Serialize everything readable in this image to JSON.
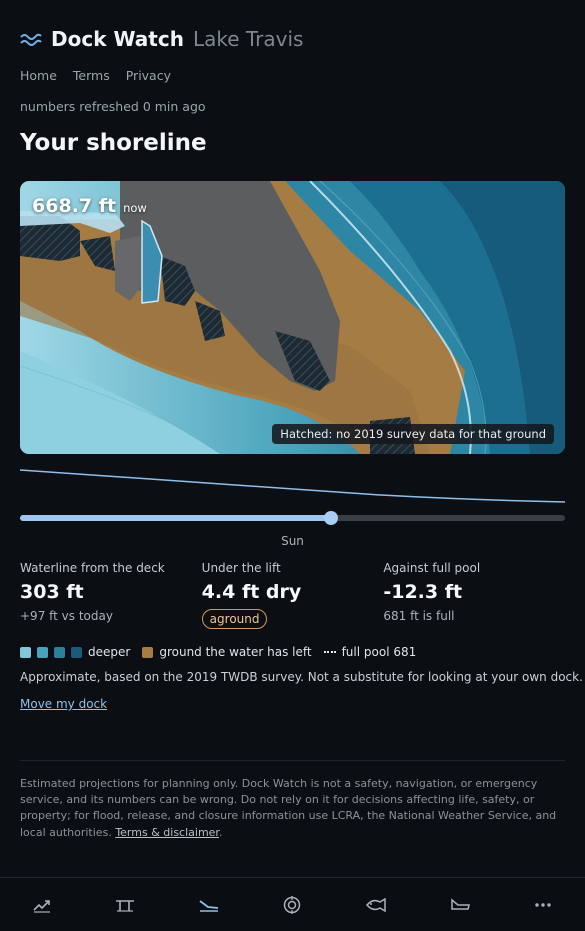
{
  "header": {
    "title": "Dock Watch",
    "lake": "Lake Travis",
    "nav": [
      "Home",
      "Terms",
      "Privacy"
    ],
    "refreshed": "numbers refreshed 0 min ago"
  },
  "section_title": "Your shoreline",
  "map": {
    "level": "668.7 ft",
    "level_suffix": "now",
    "hatch_note": "Hatched: no 2019 survey data for that ground"
  },
  "slider": {
    "day": "Sun",
    "position": 0.57
  },
  "stats": [
    {
      "label": "Waterline from the deck",
      "value": "303 ft",
      "sub": "+97 ft vs today"
    },
    {
      "label": "Under the lift",
      "value": "4.4 ft dry",
      "badge": "aground"
    },
    {
      "label": "Against full pool",
      "value": "-12.3 ft",
      "sub": "681 ft is full"
    }
  ],
  "legend": {
    "deeper": "deeper",
    "ground": "ground the water has left",
    "full_pool": "full pool 681",
    "colors": [
      "#7fc7d9",
      "#4aa3bb",
      "#2b7f9d",
      "#1a5a7d"
    ],
    "ground_color": "#a67c45"
  },
  "approx": "Approximate, based on the 2019 TWDB survey. Not a substitute for looking at your own dock.",
  "move_dock": "Move my dock",
  "disclaimer": {
    "text": "Estimated projections for planning only. Dock Watch is not a safety, navigation, or emergency service, and its numbers can be wrong. Do not rely on it for decisions affecting life, safety, or property; for flood, release, and closure information use LCRA, the National Weather Service, and local authorities.",
    "link": "Terms & disclaimer",
    "end": "."
  },
  "tabs": [
    "trend-icon",
    "dock-icon",
    "shoreline-icon",
    "target-icon",
    "fish-icon",
    "boat-icon",
    "more-icon"
  ],
  "accent": "#8fc0ec"
}
